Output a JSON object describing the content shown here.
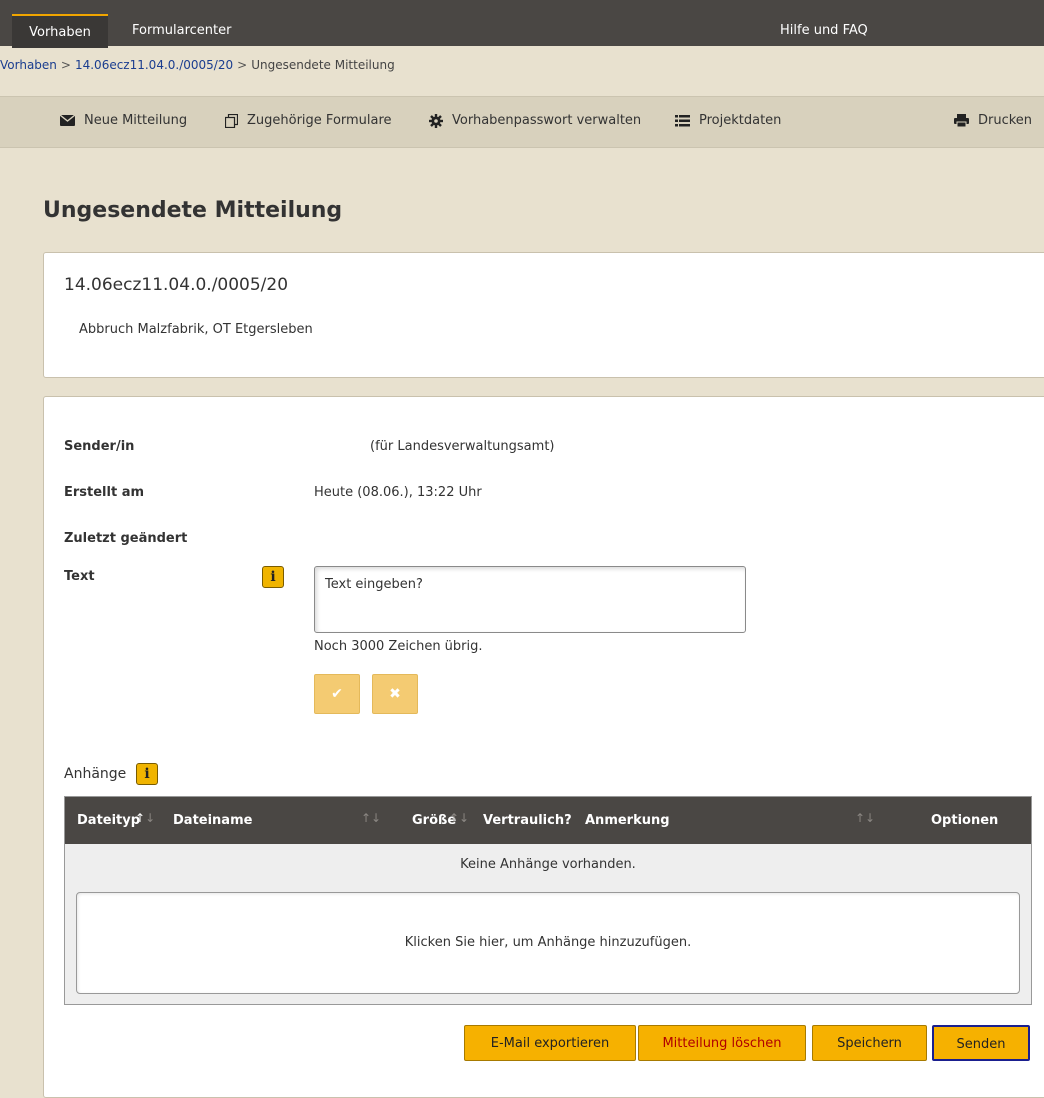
{
  "topnav": {
    "tabs": [
      {
        "label": "Vorhaben"
      },
      {
        "label": "Formularcenter"
      },
      {
        "label": "Hilfe und FAQ"
      }
    ]
  },
  "breadcrumb": {
    "items": [
      "Vorhaben",
      "14.06ecz11.04.0./0005/20",
      "Ungesendete Mitteilung"
    ],
    "separator": ">"
  },
  "toolbar": {
    "items": [
      {
        "label": "Neue Mitteilung",
        "icon": "envelope-icon"
      },
      {
        "label": "Zugehörige Formulare",
        "icon": "copy-icon"
      },
      {
        "label": "Vorhabenpasswort verwalten",
        "icon": "gear-icon"
      },
      {
        "label": "Projektdaten",
        "icon": "list-icon"
      },
      {
        "label": "Drucken",
        "icon": "printer-icon"
      }
    ]
  },
  "page": {
    "title": "Ungesendete Mitteilung"
  },
  "project": {
    "number": "14.06ecz11.04.0./0005/20",
    "description": "Abbruch Malzfabrik, OT Etgersleben"
  },
  "message": {
    "sender_label": "Sender/in",
    "sender_value": "(für Landesverwaltungsamt)",
    "created_label": "Erstellt am",
    "created_value": "Heute (08.06.), 13:22 Uhr",
    "changed_label": "Zuletzt geändert",
    "text_label": "Text",
    "text_value": "Text eingeben?",
    "chars_left": "Noch 3000 Zeichen übrig.",
    "confirm_glyph": "✔",
    "cancel_glyph": "✖",
    "info_glyph": "i"
  },
  "attachments": {
    "label": "Anhänge",
    "columns": [
      "Dateityp",
      "Dateiname",
      "Größe",
      "Vertraulich?",
      "Anmerkung",
      "Optionen"
    ],
    "empty_text": "Keine Anhänge vorhanden.",
    "dropzone_text": "Klicken Sie hier, um Anhänge hinzuzufügen."
  },
  "actions": {
    "export": "E-Mail exportieren",
    "delete": "Mitteilung löschen",
    "save": "Speichern",
    "send": "Senden"
  },
  "colors": {
    "topbar": "#4a4744",
    "accent": "#f6b100",
    "delete_text": "#b00000",
    "link": "#1a3d8f"
  }
}
